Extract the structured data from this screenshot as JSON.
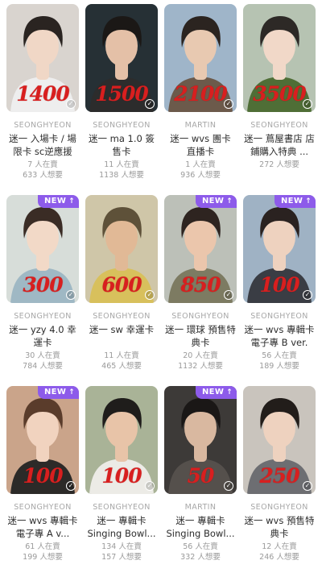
{
  "badge_new": "NEW",
  "cards": [
    {
      "brand": "SEONGHYEON",
      "title": "迷一 入場卡 / 場限卡 sc逆應援",
      "price_mark": "1400",
      "selling": "7 人在賣",
      "wanting": "633 人想要",
      "is_new": false,
      "bg": "#d9d4cf",
      "skin": "#f0d7c6",
      "hair": "#2a2421",
      "shirt": "#eeeeee"
    },
    {
      "brand": "SEONGHYEON",
      "title": "迷一 ma 1.0 簽售卡",
      "price_mark": "1500",
      "selling": "11 人在賣",
      "wanting": "1138 人想要",
      "is_new": false,
      "bg": "#263035",
      "skin": "#e4c0a7",
      "hair": "#1b1816",
      "shirt": "#2c2c2c"
    },
    {
      "brand": "MARTIN",
      "title": "迷一 wvs 團卡 直播卡",
      "price_mark": "2100",
      "selling": "1 人在賣",
      "wanting": "936 人想要",
      "is_new": false,
      "bg": "#9fb5c9",
      "skin": "#e8c9b1",
      "hair": "#2b2420",
      "shirt": "#6c5a4b"
    },
    {
      "brand": "SEONGHYEON",
      "title": "迷一 蔦屋書店 店鋪購入特典 ...",
      "price_mark": "3500",
      "selling": "",
      "wanting": "272 人想要",
      "is_new": false,
      "bg": "#b6c3b2",
      "skin": "#f1d8c8",
      "hair": "#2d2926",
      "shirt": "#4f6e36"
    },
    {
      "brand": "SEONGHYEON",
      "title": "迷一 yzy 4.0 幸運卡",
      "price_mark": "300",
      "selling": "30 人在賣",
      "wanting": "784 人想要",
      "is_new": true,
      "bg": "#d7ddd9",
      "skin": "#f2d9c7",
      "hair": "#3a2c25",
      "shirt": "#9fb8c4"
    },
    {
      "brand": "SEONGHYEON",
      "title": "迷一 sw 幸運卡",
      "price_mark": "600",
      "selling": "11 人在賣",
      "wanting": "465 人想要",
      "is_new": false,
      "bg": "#cfc6a8",
      "skin": "#e1b996",
      "hair": "#5e5139",
      "shirt": "#d8c05c"
    },
    {
      "brand": "SEONGHYEON",
      "title": "迷一 環球 預售特典卡",
      "price_mark": "850",
      "selling": "20 人在賣",
      "wanting": "1132 人想要",
      "is_new": true,
      "bg": "#bcc0b8",
      "skin": "#ebc6ac",
      "hair": "#2e2420",
      "shirt": "#7d7b62"
    },
    {
      "brand": "SEONGHYEON",
      "title": "迷一 wvs 專輯卡 電子專 B ver.",
      "price_mark": "100",
      "selling": "56 人在賣",
      "wanting": "189 人想要",
      "is_new": true,
      "bg": "#9fb2c4",
      "skin": "#eed2bf",
      "hair": "#2a2220",
      "shirt": "#3a3d44"
    },
    {
      "brand": "SEONGHYEON",
      "title": "迷一 wvs 專輯卡 電子專 A v...",
      "price_mark": "100",
      "selling": "61 人在賣",
      "wanting": "199 人想要",
      "is_new": true,
      "bg": "#caa48a",
      "skin": "#f1d3bf",
      "hair": "#5a3c2b",
      "shirt": "#2c2a28"
    },
    {
      "brand": "SEONGHYEON",
      "title": "迷一 專輯卡 Singing Bowl...",
      "price_mark": "100",
      "selling": "134 人在賣",
      "wanting": "157 人想要",
      "is_new": false,
      "bg": "#a9b397",
      "skin": "#e8c4a8",
      "hair": "#1f1d1b",
      "shirt": "#ecebe6"
    },
    {
      "brand": "MARTIN",
      "title": "迷一 專輯卡 Singing Bowl...",
      "price_mark": "50",
      "selling": "56 人在賣",
      "wanting": "332 人想要",
      "is_new": true,
      "bg": "#3d3a38",
      "skin": "#d9b8a0",
      "hair": "#1a1716",
      "shirt": "#55504c"
    },
    {
      "brand": "SEONGHYEON",
      "title": "迷一 wvs 預售特典卡",
      "price_mark": "250",
      "selling": "12 人在賣",
      "wanting": "246 人想要",
      "is_new": false,
      "bg": "#c9c4bd",
      "skin": "#eed2bf",
      "hair": "#221d1a",
      "shirt": "#6d6e72"
    }
  ]
}
